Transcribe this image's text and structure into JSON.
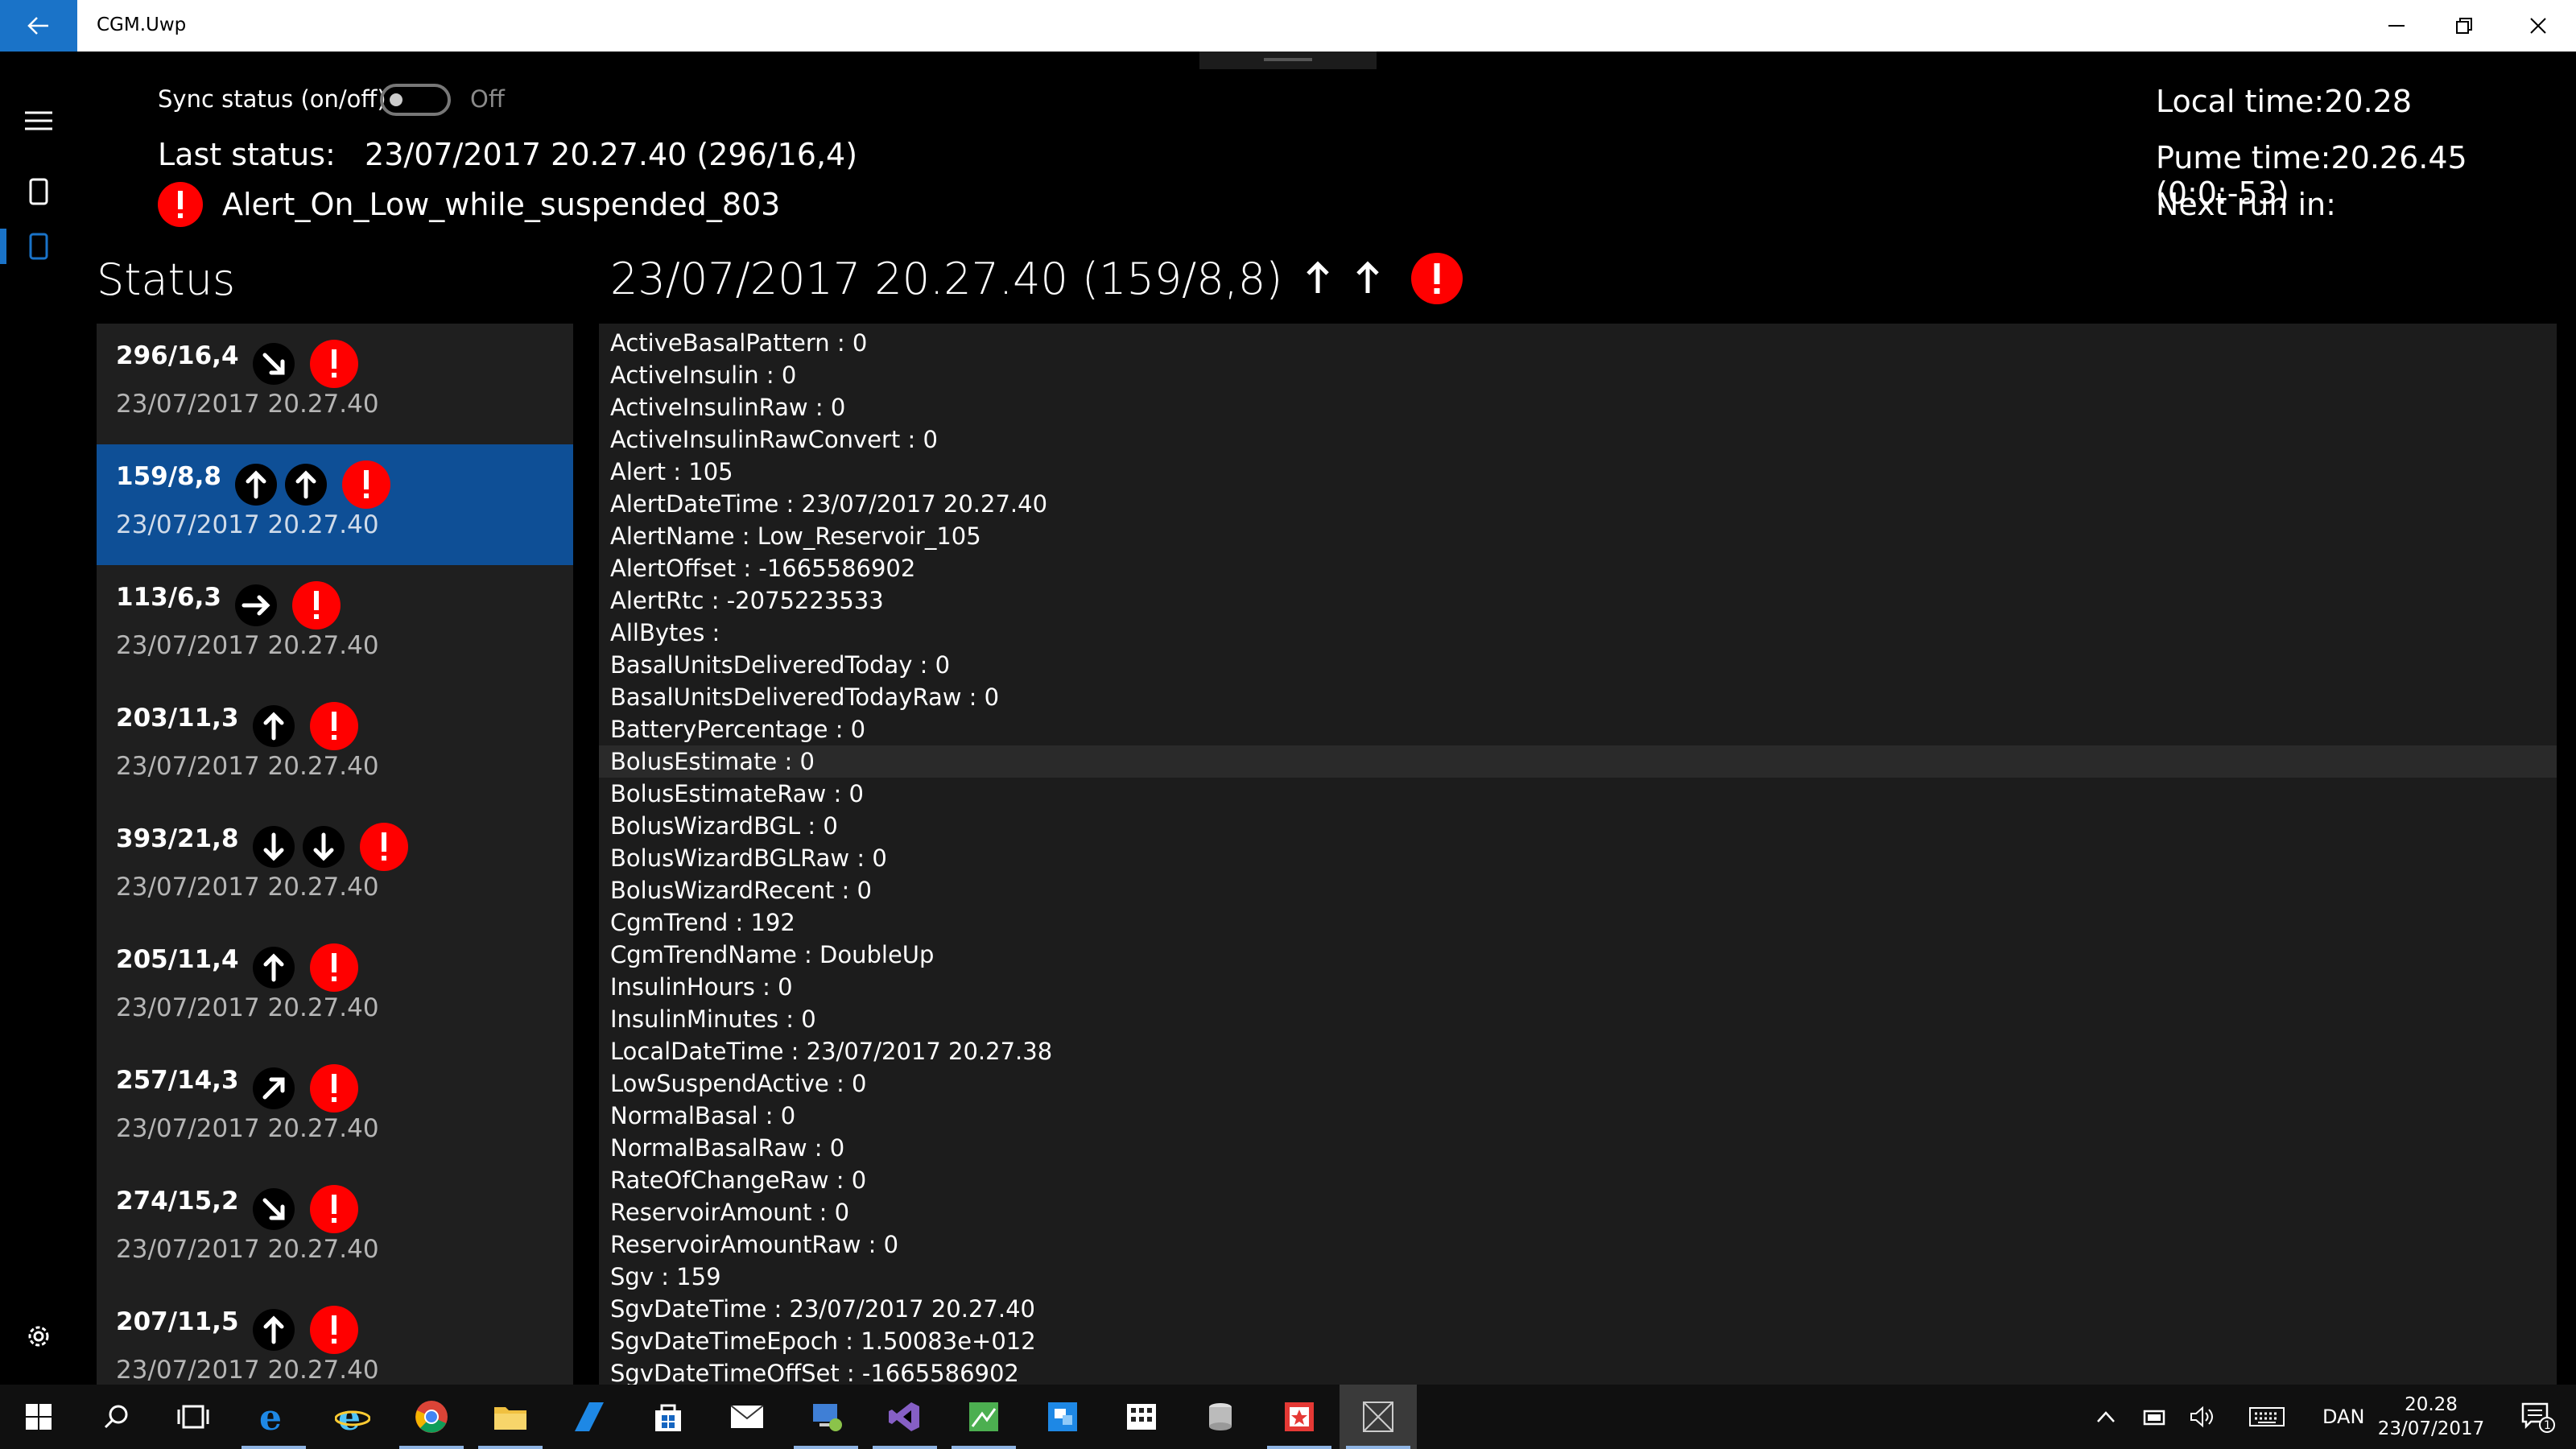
{
  "window": {
    "title": "CGM.Uwp"
  },
  "header": {
    "sync_label": "Sync status (on/off)",
    "sync_state": "Off",
    "last_status": "Last status:   23/07/2017 20.27.40 (296/16,4)",
    "alert_name": "Alert_On_Low_while_suspended_803",
    "local_time": "Local time:20.28",
    "pump_time": "Pume time:20.26.45 (0:0:-53)",
    "next_run": "Next run in:"
  },
  "status_heading": "Status",
  "status_items": [
    {
      "value": "296/16,4",
      "date": "23/07/2017 20.27.40",
      "arrows": [
        "down-right"
      ]
    },
    {
      "value": "159/8,8",
      "date": "23/07/2017 20.27.40",
      "arrows": [
        "up",
        "up"
      ]
    },
    {
      "value": "113/6,3",
      "date": "23/07/2017 20.27.40",
      "arrows": [
        "right"
      ]
    },
    {
      "value": "203/11,3",
      "date": "23/07/2017 20.27.40",
      "arrows": [
        "up"
      ]
    },
    {
      "value": "393/21,8",
      "date": "23/07/2017 20.27.40",
      "arrows": [
        "down",
        "down"
      ]
    },
    {
      "value": "205/11,4",
      "date": "23/07/2017 20.27.40",
      "arrows": [
        "up"
      ]
    },
    {
      "value": "257/14,3",
      "date": "23/07/2017 20.27.40",
      "arrows": [
        "up-right"
      ]
    },
    {
      "value": "274/15,2",
      "date": "23/07/2017 20.27.40",
      "arrows": [
        "down-right"
      ]
    },
    {
      "value": "207/11,5",
      "date": "23/07/2017 20.27.40",
      "arrows": [
        "up"
      ]
    }
  ],
  "selected_index": 1,
  "detail": {
    "title": "23/07/2017 20.27.40 (159/8,8)",
    "properties": [
      "ActiveBasalPattern : 0",
      "ActiveInsulin : 0",
      "ActiveInsulinRaw : 0",
      "ActiveInsulinRawConvert : 0",
      "Alert : 105",
      "AlertDateTime : 23/07/2017 20.27.40",
      "AlertName : Low_Reservoir_105",
      "AlertOffset : -1665586902",
      "AlertRtc : -2075223533",
      "AllBytes :",
      "BasalUnitsDeliveredToday : 0",
      "BasalUnitsDeliveredTodayRaw : 0",
      "BatteryPercentage : 0",
      "BolusEstimate : 0",
      "BolusEstimateRaw : 0",
      "BolusWizardBGL : 0",
      "BolusWizardBGLRaw : 0",
      "BolusWizardRecent : 0",
      "CgmTrend : 192",
      "CgmTrendName : DoubleUp",
      "InsulinHours : 0",
      "InsulinMinutes : 0",
      "LocalDateTime : 23/07/2017 20.27.38",
      "LowSuspendActive : 0",
      "NormalBasal : 0",
      "NormalBasalRaw : 0",
      "RateOfChangeRaw : 0",
      "ReservoirAmount : 0",
      "ReservoirAmountRaw : 0",
      "Sgv : 159",
      "SgvDateTime : 23/07/2017 20.27.40",
      "SgvDateTimeEpoch : 1.50083e+012",
      "SgvDateTimeOffSet : -1665586902"
    ],
    "highlighted_index": 13
  },
  "colors": {
    "accent": "#1a73c8",
    "selected_row": "#0e4f96",
    "alert_red": "#ff0000",
    "panel": "#1f1f1f"
  },
  "taskbar": {
    "language": "DAN",
    "time": "20.28",
    "date": "23/07/2017",
    "notification_count": "1"
  }
}
